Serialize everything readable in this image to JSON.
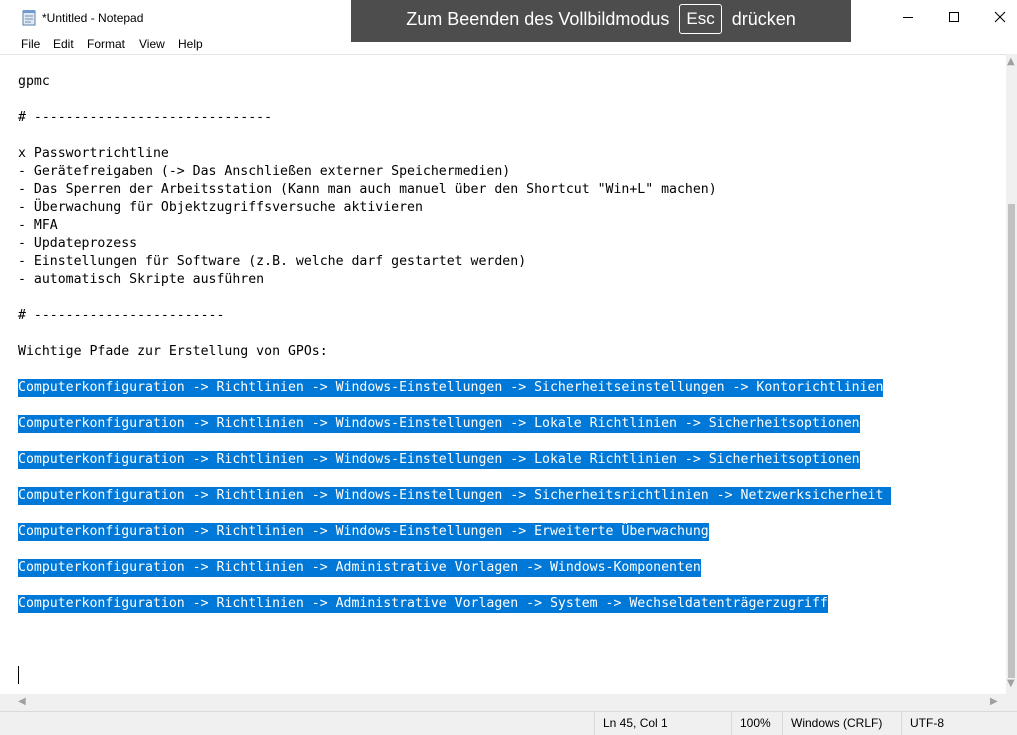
{
  "window": {
    "title": "*Untitled - Notepad",
    "controls": [
      "minimize",
      "maximize",
      "close"
    ]
  },
  "fullscreen_notice": {
    "prefix": "Zum Beenden des Vollbildmodus",
    "key": "Esc",
    "suffix": "drücken"
  },
  "menu": {
    "items": [
      "File",
      "Edit",
      "Format",
      "View",
      "Help"
    ]
  },
  "editor": {
    "lines": [
      {
        "text": "gpmc",
        "selected": false
      },
      {
        "text": "# ------------------------------",
        "selected": false
      },
      {
        "text": "x Passwortrichtline",
        "selected": false
      },
      {
        "text": "- Gerätefreigaben (-> Das Anschließen externer Speichermedien)",
        "selected": false
      },
      {
        "text": "- Das Sperren der Arbeitsstation (Kann man auch manuel über den Shortcut \"Win+L\" machen)",
        "selected": false
      },
      {
        "text": "- Überwachung für Objektzugriffsversuche aktivieren",
        "selected": false
      },
      {
        "text": "- MFA",
        "selected": false
      },
      {
        "text": "- Updateprozess",
        "selected": false
      },
      {
        "text": "- Einstellungen für Software (z.B. welche darf gestartet werden)",
        "selected": false
      },
      {
        "text": "- automatisch Skripte ausführen",
        "selected": false
      },
      {
        "text": "# ------------------------",
        "selected": false
      },
      {
        "text": "Wichtige Pfade zur Erstellung von GPOs:",
        "selected": false
      },
      {
        "text": "Computerkonfiguration -> Richtlinien -> Windows-Einstellungen -> Sicherheitseinstellungen -> Kontorichtlinien",
        "selected": true
      },
      {
        "text": "Computerkonfiguration -> Richtlinien -> Windows-Einstellungen -> Lokale Richtlinien -> Sicherheitsoptionen",
        "selected": true
      },
      {
        "text": "Computerkonfiguration -> Richtlinien -> Windows-Einstellungen -> Lokale Richtlinien -> Sicherheitsoptionen",
        "selected": true
      },
      {
        "text": "Computerkonfiguration -> Richtlinien -> Windows-Einstellungen -> Sicherheitsrichtlinien -> Netzwerksicherheit ",
        "selected": true
      },
      {
        "text": "Computerkonfiguration -> Richtlinien -> Windows-Einstellungen -> Erweiterte Überwachung",
        "selected": true
      },
      {
        "text": "Computerkonfiguration -> Richtlinien -> Administrative Vorlagen -> Windows-Komponenten",
        "selected": true
      },
      {
        "text": "Computerkonfiguration -> Richtlinien -> Administrative Vorlagen -> System -> Wechseldatenträgerzugriff",
        "selected": true
      }
    ],
    "selection_color": "#0078d7"
  },
  "status": {
    "position": "Ln 45, Col 1",
    "zoom": "100%",
    "line_endings": "Windows (CRLF)",
    "encoding": "UTF-8"
  }
}
